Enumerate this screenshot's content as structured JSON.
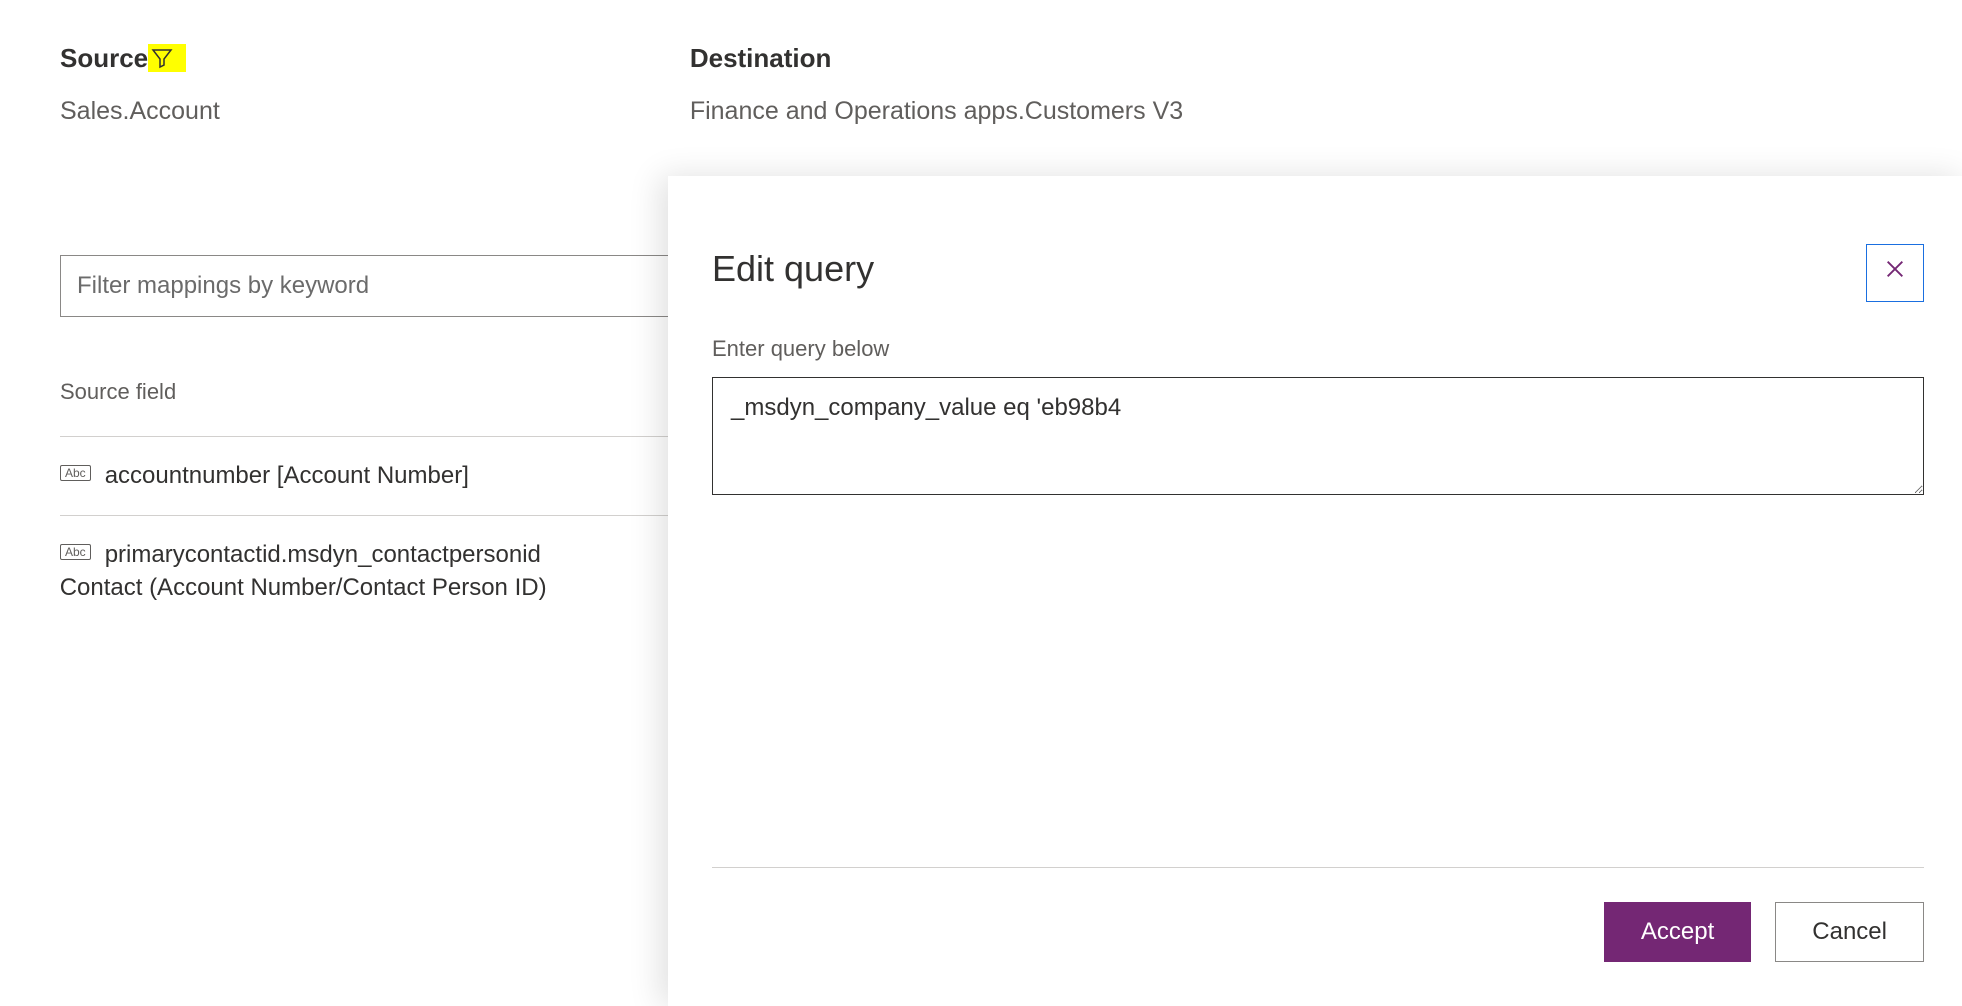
{
  "header": {
    "source_label": "Source",
    "source_value": "Sales.Account",
    "dest_label": "Destination",
    "dest_value": "Finance and Operations apps.Customers V3"
  },
  "filter": {
    "placeholder": "Filter mappings by keyword"
  },
  "list": {
    "header": "Source field",
    "rows": [
      {
        "icon": "Abc",
        "text": "accountnumber [Account Number]",
        "second": ""
      },
      {
        "icon": "Abc",
        "text": "primarycontactid.msdyn_contactpersonid",
        "second": "Contact (Account Number/Contact Person ID)"
      }
    ]
  },
  "dialog": {
    "title": "Edit query",
    "label": "Enter query below",
    "query": "_msdyn_company_value eq 'eb98b4",
    "accept": "Accept",
    "cancel": "Cancel"
  }
}
